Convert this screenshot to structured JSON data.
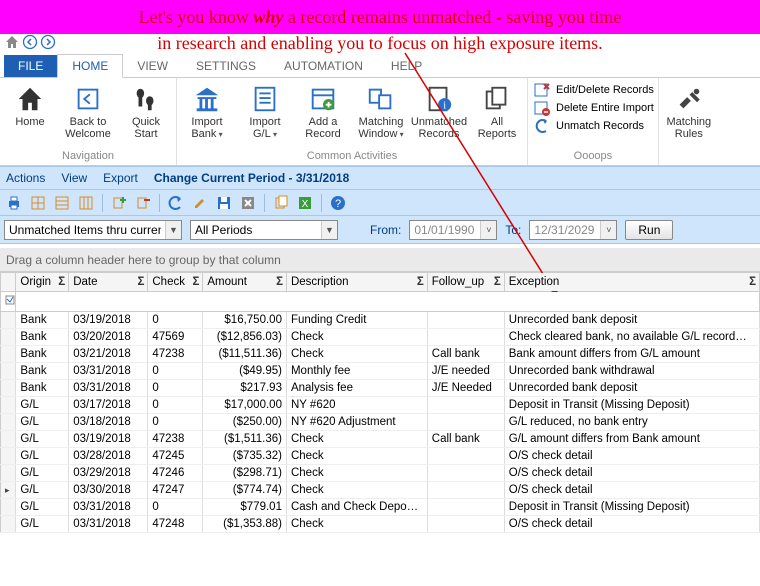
{
  "banner": {
    "line1_pre": "Let's you know ",
    "line1_em": "why",
    "line1_post": " a record remains unmatched - saving you time",
    "line2": "in research and enabling you to focus on high exposure items."
  },
  "tabs": {
    "file": "FILE",
    "items": [
      "HOME",
      "VIEW",
      "SETTINGS",
      "AUTOMATION",
      "HELP"
    ],
    "active_index": 0
  },
  "ribbon": {
    "groups": {
      "navigation": {
        "label": "Navigation",
        "home": "Home",
        "back": "Back to\nWelcome",
        "quick": "Quick\nStart"
      },
      "common": {
        "label": "Common Activities",
        "import_bank": "Import\nBank",
        "import_gl": "Import\nG/L",
        "add_record": "Add a\nRecord",
        "matching_window": "Matching\nWindow",
        "unmatched": "Unmatched\nRecords",
        "all_reports": "All\nReports"
      },
      "ooops": {
        "label": "Oooops",
        "edit_delete": "Edit/Delete Records",
        "delete_import": "Delete Entire Import",
        "unmatch": "Unmatch Records"
      },
      "rules": {
        "label": "",
        "matching_rules": "Matching\nRules"
      }
    }
  },
  "subtoolbar": {
    "actions": "Actions",
    "view": "View",
    "export": "Export",
    "status": "Change Current Period - 3/31/2018"
  },
  "filterbar": {
    "scope_value": "Unmatched Items thru current",
    "period_value": "All Periods",
    "from_label": "From:",
    "from_value": "01/01/1990",
    "to_label": "To:",
    "to_value": "12/31/2029",
    "run": "Run"
  },
  "groupbar": "Drag a column header here to group by that column",
  "grid": {
    "columns": [
      "Origin",
      "Date",
      "Check",
      "Amount",
      "Description",
      "Follow_up",
      "Exception"
    ],
    "rows": [
      {
        "origin": "Bank",
        "date": "03/19/2018",
        "check": "0",
        "amount": "$16,750.00",
        "desc": "Funding Credit",
        "follow": "",
        "exc": "Unrecorded bank deposit"
      },
      {
        "origin": "Bank",
        "date": "03/20/2018",
        "check": "47569",
        "amount": "($12,856.03)",
        "desc": "Check",
        "follow": "",
        "exc": "Check cleared bank, no available G/L record…"
      },
      {
        "origin": "Bank",
        "date": "03/21/2018",
        "check": "47238",
        "amount": "($11,511.36)",
        "desc": "Check",
        "follow": "Call bank",
        "exc": "Bank amount differs from G/L amount"
      },
      {
        "origin": "Bank",
        "date": "03/31/2018",
        "check": "0",
        "amount": "($49.95)",
        "desc": "Monthly fee",
        "follow": "J/E needed",
        "exc": "Unrecorded bank withdrawal"
      },
      {
        "origin": "Bank",
        "date": "03/31/2018",
        "check": "0",
        "amount": "$217.93",
        "desc": "Analysis fee",
        "follow": "J/E Needed",
        "exc": "Unrecorded bank deposit"
      },
      {
        "origin": "G/L",
        "date": "03/17/2018",
        "check": "0",
        "amount": "$17,000.00",
        "desc": "NY #620",
        "follow": "",
        "exc": "Deposit in Transit (Missing Deposit)"
      },
      {
        "origin": "G/L",
        "date": "03/18/2018",
        "check": "0",
        "amount": "($250.00)",
        "desc": "NY #620 Adjustment",
        "follow": "",
        "exc": "G/L reduced, no bank entry"
      },
      {
        "origin": "G/L",
        "date": "03/19/2018",
        "check": "47238",
        "amount": "($1,511.36)",
        "desc": "Check",
        "follow": "Call bank",
        "exc": "G/L amount differs from Bank amount"
      },
      {
        "origin": "G/L",
        "date": "03/28/2018",
        "check": "47245",
        "amount": "($735.32)",
        "desc": "Check",
        "follow": "",
        "exc": "O/S check detail"
      },
      {
        "origin": "G/L",
        "date": "03/29/2018",
        "check": "47246",
        "amount": "($298.71)",
        "desc": "Check",
        "follow": "",
        "exc": "O/S check detail"
      },
      {
        "origin": "G/L",
        "date": "03/30/2018",
        "check": "47247",
        "amount": "($774.74)",
        "desc": "Check",
        "follow": "",
        "exc": "O/S check detail",
        "marker": true
      },
      {
        "origin": "G/L",
        "date": "03/31/2018",
        "check": "0",
        "amount": "$779.01",
        "desc": "Cash and Check Depo…",
        "follow": "",
        "exc": "Deposit in Transit (Missing Deposit)"
      },
      {
        "origin": "G/L",
        "date": "03/31/2018",
        "check": "47248",
        "amount": "($1,353.88)",
        "desc": "Check",
        "follow": "",
        "exc": "O/S check detail"
      }
    ]
  }
}
